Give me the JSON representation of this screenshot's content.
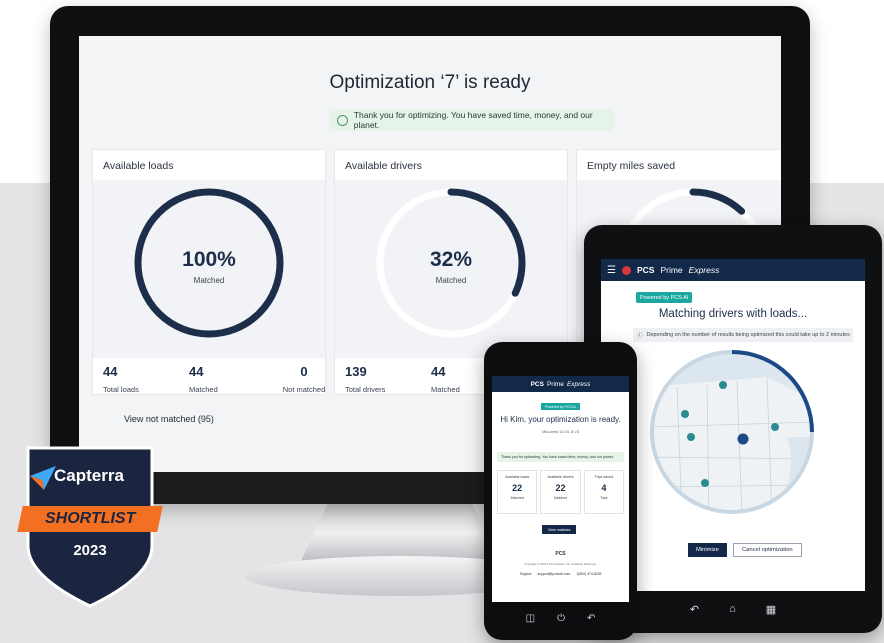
{
  "desktop": {
    "title": "Optimization ‘7’ is ready",
    "thanks": "Thank you for optimizing. You have saved time, money, and our planet.",
    "cards": [
      {
        "title": "Available loads",
        "percent": "100%",
        "fill": 1.0,
        "sub": "Matched",
        "stats": [
          {
            "value": "44",
            "label": "Total loads"
          },
          {
            "value": "44",
            "label": "Matched"
          },
          {
            "value": "0",
            "label": "Not matched"
          }
        ]
      },
      {
        "title": "Available drivers",
        "percent": "32%",
        "fill": 0.32,
        "sub": "Matched",
        "stats": [
          {
            "value": "139",
            "label": "Total drivers"
          },
          {
            "value": "44",
            "label": "Matched"
          }
        ]
      },
      {
        "title": "Empty miles saved",
        "fill": 0.12
      }
    ],
    "view_not_matched": "View not matched (95)",
    "ring_color": "#1c2e4a",
    "track_color": "#ffffff"
  },
  "tablet": {
    "menu_icon": "hamburger-icon",
    "brand": "PCS",
    "product": "Prime",
    "product_suffix": "Express",
    "ai_badge": "Powered by PCS AI",
    "title": "Matching drivers with loads...",
    "note": "Depending on the number of results being optimized this could take up to 2 minutes",
    "progress": 0.25,
    "minimize": "Minimize",
    "cancel": "Cancel optimization"
  },
  "phone": {
    "brand": "PCS",
    "product": "Prime",
    "product_suffix": "Express",
    "ai_badge": "Powered by PCS AI",
    "title": "Hi Kim, your optimization is ready.",
    "sub": "Mid-west 11.04, 8:23",
    "thanks": "Thank you for optimizing. You have saved time, money, and our planet.",
    "cards": [
      {
        "title": "Available loads",
        "value": "22",
        "label": "Matched"
      },
      {
        "title": "Available drivers",
        "value": "22",
        "label": "Matched"
      },
      {
        "title": "Trips saved",
        "value": "4",
        "label": "Trips"
      }
    ],
    "view_matches": "View matches",
    "footer_logo": "PCS",
    "copyright": "Copyright © 2022 PCS Software, Inc. All Rights Reserved.",
    "support_label": "Support",
    "support_email": "support@pcssoft.com",
    "support_phone": "1(800) 474-8239"
  },
  "badge": {
    "brand": "Capterra",
    "ribbon": "SHORTLIST",
    "year": "2023",
    "shield_color": "#1c2540",
    "ribbon_color": "#f36f21"
  }
}
